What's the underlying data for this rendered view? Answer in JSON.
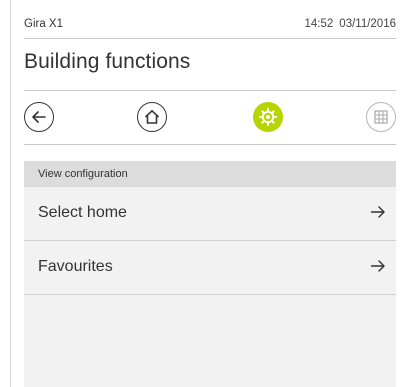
{
  "status_bar": {
    "app_name": "Gira X1",
    "time": "14:52",
    "date": "03/11/2016"
  },
  "page": {
    "title": "Building functions"
  },
  "nav": {
    "buttons": [
      {
        "name": "back",
        "icon": "arrow-left-icon"
      },
      {
        "name": "home",
        "icon": "house-icon"
      },
      {
        "name": "settings",
        "icon": "gear-icon",
        "active": true,
        "color": "#b8d400"
      },
      {
        "name": "grid",
        "icon": "grid-icon",
        "disabled": true
      }
    ]
  },
  "section": {
    "header": "View configuration",
    "items": [
      {
        "label": "Select home",
        "icon": "arrow-right-icon"
      },
      {
        "label": "Favourites",
        "icon": "arrow-right-icon"
      }
    ]
  }
}
